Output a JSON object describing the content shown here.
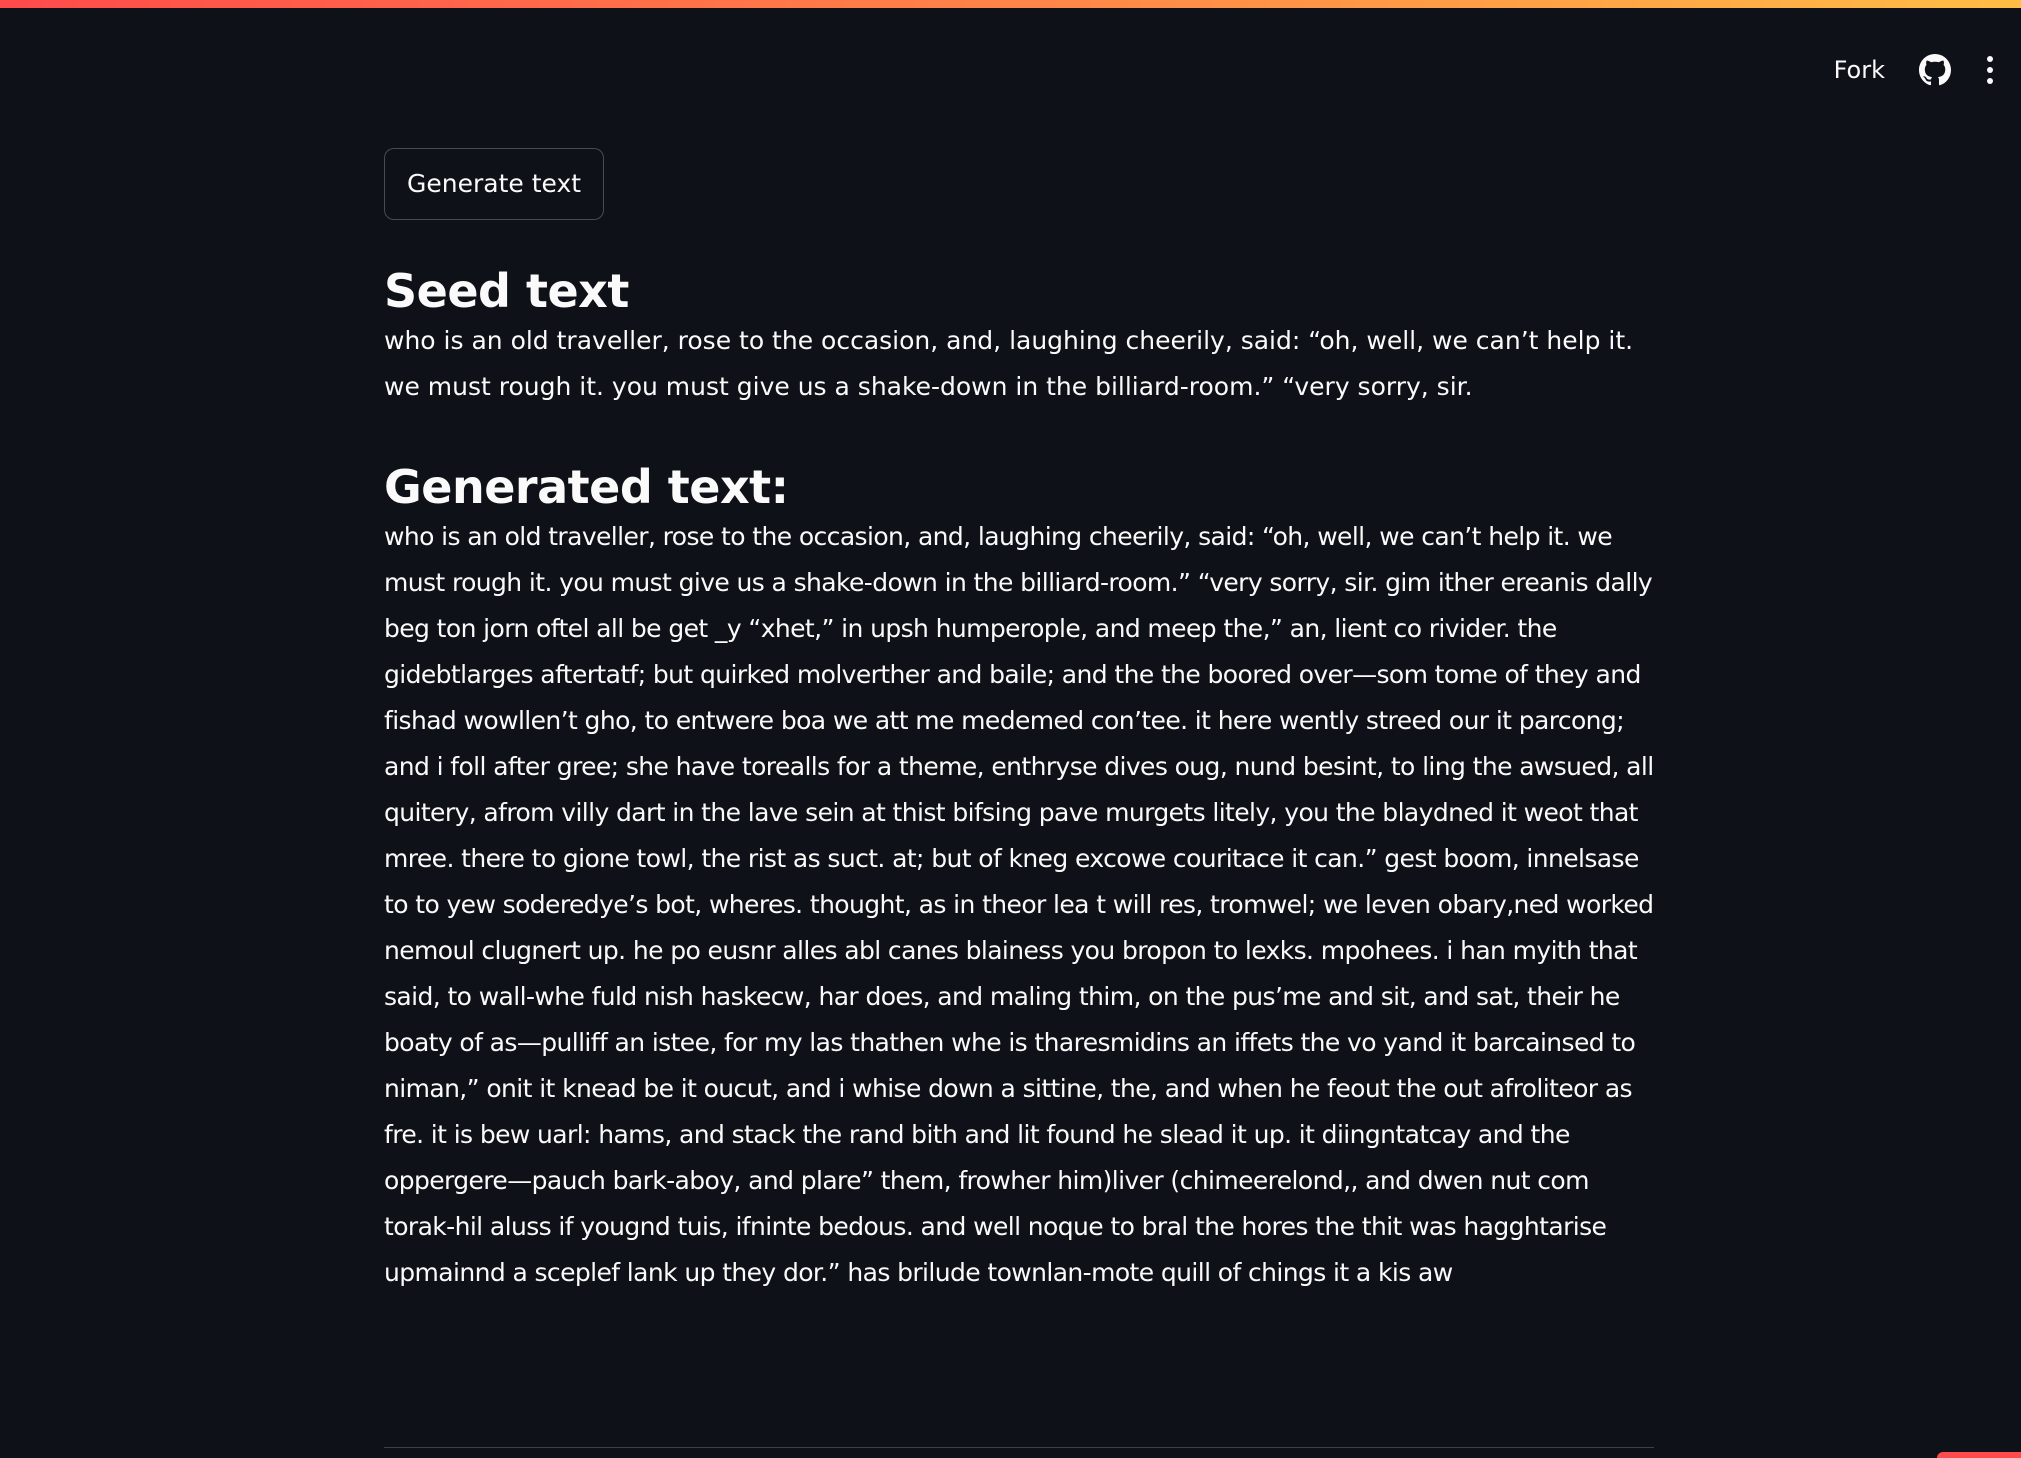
{
  "header": {
    "fork_label": "Fork",
    "icons": [
      "github-icon",
      "more-vertical-icon"
    ],
    "decoration_colors": [
      "#ff4b4b",
      "#ffbd45"
    ]
  },
  "main": {
    "generate_button_label": "Generate text",
    "seed_heading": "Seed text",
    "seed_text": "who is an old traveller, rose to the occasion, and, laughing cheerily, said: “oh, well, we can’t help it. we must rough it. you must give us a shake-down in the billiard-room.” “very sorry, sir.",
    "generated_heading": "Generated text:",
    "generated_text": "who is an old traveller, rose to the occasion, and, laughing cheerily, said: “oh, well, we can’t help it. we must rough it. you must give us a shake-down in the billiard-room.” “very sorry, sir. gim ither ereanis dally beg ton jorn oftel all be get _y “xhet,” in upsh humperople, and meep the,” an, lient co rivider. the gidebtlarges aftertatf; but quirked molverther and baile; and the the boored over—som tome of they and fishad wowllen’t gho, to entwere boa we att me medemed con’tee. it here wently streed our it parcong; and i foll after gree; she have torealls for a theme, enthryse dives oug, nund besint, to ling the awsued, all quitery, afrom villy dart in the lave sein at thist bifsing pave murgets litely, you the blaydned it weot that mree. there to gione towl, the rist as suct. at; but of kneg excowe couritace it can.” gest boom, innelsase to to yew soderedye’s bot, wheres. thought, as in theor lea t will res, tromwel; we leven obary,ned worked nemoul clugnert up. he po eusnr alles abl canes blainess you bropon to lexks. mpohees. i han myith that said, to wall-whe fuld nish haskecw, har does, and maling thim, on the pus’me and sit, and sat, their he boaty of as—pulliff an istee, for my las thathen whe is tharesmidins an iffets the vo yand it barcainsed to niman,” onit it knead be it oucut, and i whise down a sittine, the, and when he feout the out afroliteor as fre. it is bew uarl: hams, and stack the rand bith and lit found he slead it up. it diingntatcay and the oppergere—pauch bark-aboy, and plare” them, frowher him)liver (chimeerelond,, and dwen nut com torak-hil aluss if yougnd tuis, ifninte bedous. and well noque to bral the hores the thit was hagghtarise upmainnd a sceplef lank up they dor.” has brilude townlan-mote quill of chings it a kis aw"
  },
  "theme": {
    "background": "#0e1117",
    "text": "#fafafa",
    "accent": "#ff4b4b"
  }
}
